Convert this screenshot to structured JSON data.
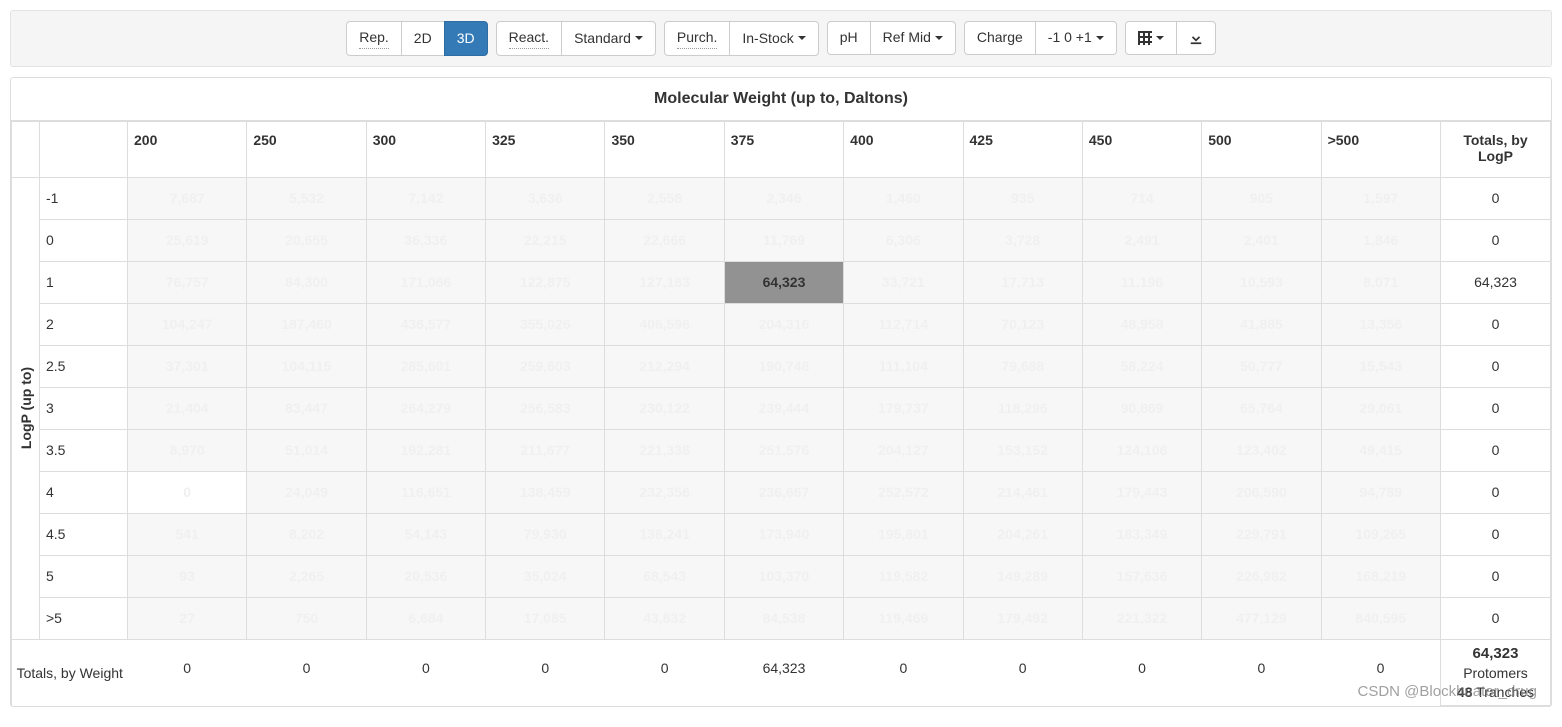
{
  "toolbar": {
    "rep_label": "Rep.",
    "view2d_label": "2D",
    "view3d_label": "3D",
    "react_label": "React.",
    "standard_label": "Standard",
    "purch_label": "Purch.",
    "instock_label": "In-Stock",
    "ph_label": "pH",
    "refmid_label": "Ref Mid",
    "charge_label": "Charge",
    "charge_values": "-1 0 +1"
  },
  "panel": {
    "title": "Molecular Weight (up to, Daltons)",
    "logp_axis": "LogP (up to)",
    "totals_by_logp": "Totals, by LogP",
    "totals_by_weight": "Totals, by Weight",
    "protomers_label": "Protomers",
    "tranches_label": "Tranches"
  },
  "columns": [
    "200",
    "250",
    "300",
    "325",
    "350",
    "375",
    "400",
    "425",
    "450",
    "500",
    ">500"
  ],
  "rows": [
    {
      "label": "-1",
      "cells": [
        "7,687",
        "5,532",
        "7,142",
        "3,636",
        "2,558",
        "2,346",
        "1,460",
        "935",
        "714",
        "905",
        "1,597"
      ],
      "total": "0"
    },
    {
      "label": "0",
      "cells": [
        "25,619",
        "20,655",
        "36,336",
        "22,215",
        "22,666",
        "11,769",
        "6,306",
        "3,728",
        "2,491",
        "2,401",
        "1,846"
      ],
      "total": "0"
    },
    {
      "label": "1",
      "cells": [
        "76,757",
        "84,300",
        "171,066",
        "122,875",
        "127,183",
        "64,323",
        "33,721",
        "17,713",
        "11,196",
        "10,593",
        "8,071"
      ],
      "total": "64,323",
      "selected": 5
    },
    {
      "label": "2",
      "cells": [
        "104,247",
        "187,460",
        "436,577",
        "355,026",
        "406,596",
        "204,316",
        "112,714",
        "70,123",
        "48,958",
        "41,885",
        "13,356"
      ],
      "total": "0"
    },
    {
      "label": "2.5",
      "cells": [
        "37,301",
        "104,115",
        "285,601",
        "259,603",
        "212,294",
        "190,748",
        "111,104",
        "79,688",
        "58,224",
        "50,777",
        "15,543"
      ],
      "total": "0"
    },
    {
      "label": "3",
      "cells": [
        "21,404",
        "83,447",
        "264,279",
        "256,583",
        "230,122",
        "239,444",
        "179,737",
        "118,296",
        "90,869",
        "65,764",
        "29,061"
      ],
      "total": "0"
    },
    {
      "label": "3.5",
      "cells": [
        "8,970",
        "51,014",
        "192,281",
        "211,677",
        "221,338",
        "251,576",
        "204,127",
        "153,152",
        "124,106",
        "123,402",
        "49,415"
      ],
      "total": "0"
    },
    {
      "label": "4",
      "cells": [
        "0",
        "24,049",
        "116,651",
        "138,459",
        "232,356",
        "236,667",
        "252,572",
        "214,461",
        "179,443",
        "206,590",
        "94,789"
      ],
      "total": "0",
      "whiteFirst": true
    },
    {
      "label": "4.5",
      "cells": [
        "541",
        "8,202",
        "54,143",
        "79,930",
        "138,241",
        "173,940",
        "195,801",
        "204,261",
        "183,349",
        "229,791",
        "109,265"
      ],
      "total": "0"
    },
    {
      "label": "5",
      "cells": [
        "93",
        "2,265",
        "20,536",
        "35,024",
        "68,543",
        "103,370",
        "119,582",
        "149,289",
        "157,636",
        "226,982",
        "168,219"
      ],
      "total": "0"
    },
    {
      "label": ">5",
      "cells": [
        "27",
        "750",
        "6,684",
        "17,085",
        "43,832",
        "84,538",
        "119,469",
        "179,492",
        "221,322",
        "477,129",
        "840,595"
      ],
      "total": "0"
    }
  ],
  "column_totals": [
    "0",
    "0",
    "0",
    "0",
    "0",
    "64,323",
    "0",
    "0",
    "0",
    "0",
    "0"
  ],
  "grand_total": "64,323",
  "tranche_count": "48",
  "watermark": "CSDN @Blockbuater_drug"
}
